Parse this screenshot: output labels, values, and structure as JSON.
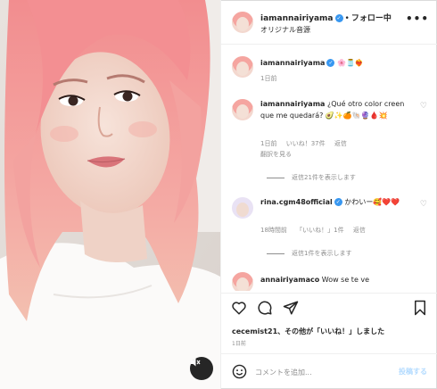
{
  "header": {
    "username": "iamannairiyama",
    "separator": "•",
    "follow_label": "フォロー中",
    "audio": "オリジナル音源",
    "more": "•••"
  },
  "caption": {
    "username": "iamannairiyama",
    "text": "🌸🫙❤️‍🔥",
    "time": "1日前"
  },
  "comments": [
    {
      "username": "iamannairiyama",
      "text": "¿Qué otro color creen que me quedará? 🥑✨🍊🐚🔮🩸💥",
      "time": "1日前",
      "likes": "いいね！37件",
      "reply": "返信",
      "translate": "翻訳を見る",
      "replies": "返信21件を表示します"
    },
    {
      "username": "rina.cgm48official",
      "text": "かわいー🥰❤️❤️",
      "time": "18時間前",
      "likes": "「いいね！」1件",
      "reply": "返信",
      "replies": "返信1件を表示します"
    },
    {
      "username": "annairiyamaco",
      "text": "Wow se te ve"
    }
  ],
  "footer": {
    "liked_user": "cecemist21",
    "liked_rest": "、その他が「いいね！」しました",
    "date": "1日前",
    "comment_placeholder": "コメントを追加...",
    "post_label": "投稿する"
  },
  "icons": {
    "verified": "verified-badge-icon",
    "heart": "heart-icon",
    "comment": "comment-icon",
    "share": "share-icon",
    "save": "bookmark-icon",
    "emoji": "smiley-icon",
    "mute": "speaker-muted-icon"
  },
  "colors": {
    "accent": "#3897f0",
    "post_button": "#b3dbff",
    "muted_text": "#8e8e8e"
  }
}
